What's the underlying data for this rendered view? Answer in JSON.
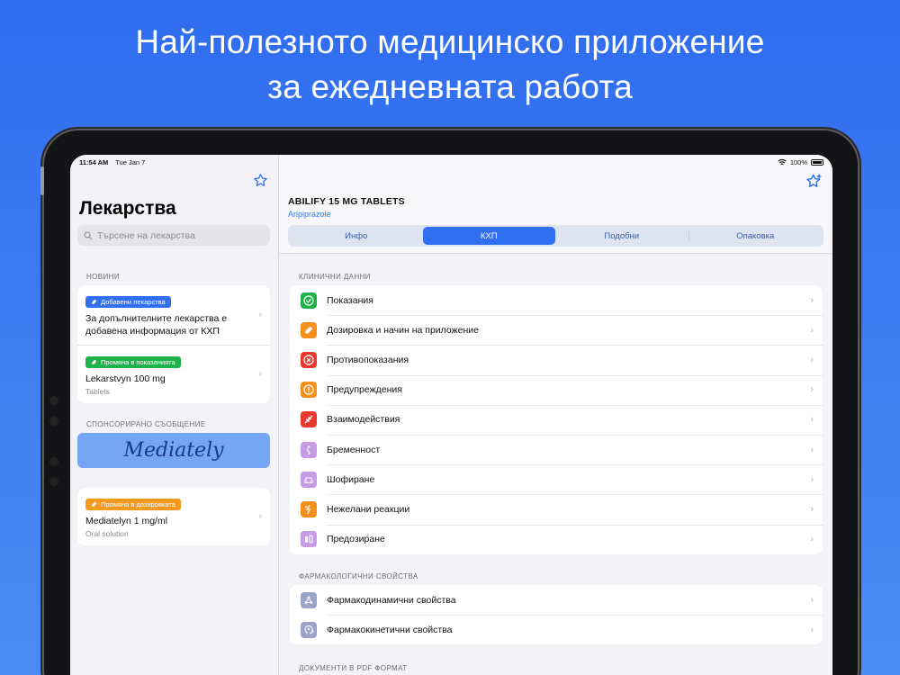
{
  "headline": {
    "line1": "Най-полезното медицинско приложение",
    "line2": "за ежедневната работа"
  },
  "status": {
    "time": "11:54 AM",
    "date": "Tue Jan 7",
    "battery": "100%"
  },
  "sidebar": {
    "title": "Лекарства",
    "search_placeholder": "Търсене на лекарства",
    "news_label": "НОВИНИ",
    "news": [
      {
        "badge": "Добавени лекарства",
        "badge_color": "#2f6ff0",
        "title": "За допълнителните лекарства е добавена информация от КХП",
        "subtitle": ""
      },
      {
        "badge": "Промяна в показанията",
        "badge_color": "#1fb24a",
        "title": "Lekarstvyn 100 mg",
        "subtitle": "Tablets"
      }
    ],
    "sponsored_label": "СПОНСОРИРАНО СЪОБЩЕНИЕ",
    "sponsor_brand": "Mediately",
    "news2": [
      {
        "badge": "Промяна в дозировката",
        "badge_color": "#f59a1c",
        "title": "Mediatelyn 1 mg/ml",
        "subtitle": "Oral solution"
      }
    ]
  },
  "drug": {
    "name": "ABILIFY 15 MG TABLETS",
    "substance": "Aripiprazole",
    "tabs": [
      "Инфо",
      "КХП",
      "Подобни",
      "Опаковка"
    ],
    "active_tab": 1
  },
  "sections": {
    "clinical_label": "КЛИНИЧНИ ДАННИ",
    "clinical": [
      {
        "label": "Показания",
        "icon": "check-icon",
        "color": "#1fb24a"
      },
      {
        "label": "Дозировка и начин на приложение",
        "icon": "pill-icon",
        "color": "#f5901c"
      },
      {
        "label": "Противопоказания",
        "icon": "cross-circle-icon",
        "color": "#e8392f"
      },
      {
        "label": "Предупреждения",
        "icon": "warning-icon",
        "color": "#f5901c"
      },
      {
        "label": "Взаимодействия",
        "icon": "arrows-icon",
        "color": "#e8392f"
      },
      {
        "label": "Бременност",
        "icon": "pregnancy-icon",
        "color": "#c79ae6"
      },
      {
        "label": "Шофиране",
        "icon": "car-icon",
        "color": "#c79ae6"
      },
      {
        "label": "Нежелани реакции",
        "icon": "reaction-icon",
        "color": "#f5901c"
      },
      {
        "label": "Предозиране",
        "icon": "overdose-icon",
        "color": "#c79ae6"
      }
    ],
    "pharma_label": "ФАРМАКОЛОГИЧНИ СВОЙСТВА",
    "pharma": [
      {
        "label": "Фармакодинамични свойства",
        "icon": "molecule-icon",
        "color": "#9aa3c9"
      },
      {
        "label": "Фармакокинетични свойства",
        "icon": "head-icon",
        "color": "#9aa3c9"
      }
    ],
    "pdf_label": "ДОКУМЕНТИ В PDF ФОРМАТ"
  }
}
